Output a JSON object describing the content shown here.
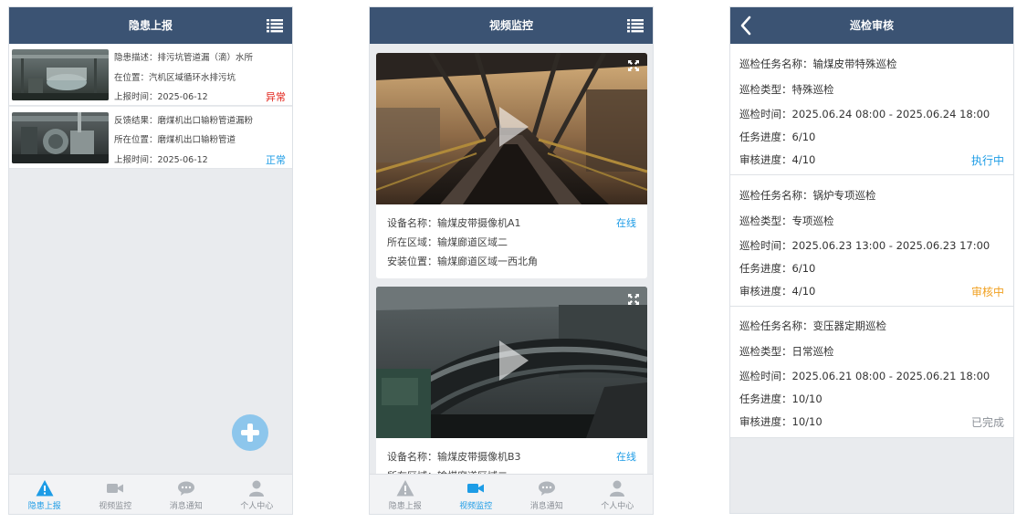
{
  "panel1": {
    "header_title": "隐患上报",
    "reports": [
      {
        "line1": "隐患描述：排污坑管道漏（滴）水所",
        "line2": "在位置：汽机区域循环水排污坑",
        "line3": "上报时间：2025-06-12",
        "status": "异常",
        "status_color": "#e2231a"
      },
      {
        "line1": "反馈结果：磨煤机出口输粉管道漏粉",
        "line2": "所在位置：磨煤机出口输粉管道",
        "line3": "上报时间：2025-06-12",
        "status": "正常",
        "status_color": "#1d9ce6"
      }
    ],
    "tabs": [
      "隐患上报",
      "视频监控",
      "消息通知",
      "个人中心"
    ]
  },
  "panel2": {
    "header_title": "视频监控",
    "cameras": [
      {
        "name": "设备名称：输煤皮带摄像机A1",
        "area": "所在区域：输煤廊道区域二",
        "location": "安装位置：输煤廊道区域一西北角",
        "status": "在线"
      },
      {
        "name": "设备名称：输煤皮带摄像机B3",
        "area": "所在区域：输煤廊道区域二",
        "status": "在线"
      }
    ],
    "tabs": [
      "隐患上报",
      "视频监控",
      "消息通知",
      "个人中心"
    ]
  },
  "panel3": {
    "header_title": "巡检审核",
    "tasks": [
      {
        "name": "巡检任务名称：输煤皮带特殊巡检",
        "type": "巡检类型：特殊巡检",
        "time": "巡检时间：2025.06.24 08:00 - 2025.06.24 18:00",
        "progress": "任务进度：6/10",
        "review": "审核进度：4/10",
        "status": "执行中",
        "status_color": "#1d9ce6"
      },
      {
        "name": "巡检任务名称：锅炉专项巡检",
        "type": "巡检类型：专项巡检",
        "time": "巡检时间：2025.06.23 13:00 - 2025.06.23 17:00",
        "progress": "任务进度：6/10",
        "review": "审核进度：4/10",
        "status": "审核中",
        "status_color": "#f0a020"
      },
      {
        "name": "巡检任务名称：变压器定期巡检",
        "type": "巡检类型：日常巡检",
        "time": "巡检时间：2025.06.21 08:00 - 2025.06.21 18:00",
        "progress": "任务进度：10/10",
        "review": "审核进度：10/10",
        "status": "已完成",
        "status_color": "#8a8f96"
      }
    ]
  },
  "colors": {
    "header": "#3b5373",
    "accent": "#1d9ce6",
    "fab": "#8dc6ec"
  }
}
